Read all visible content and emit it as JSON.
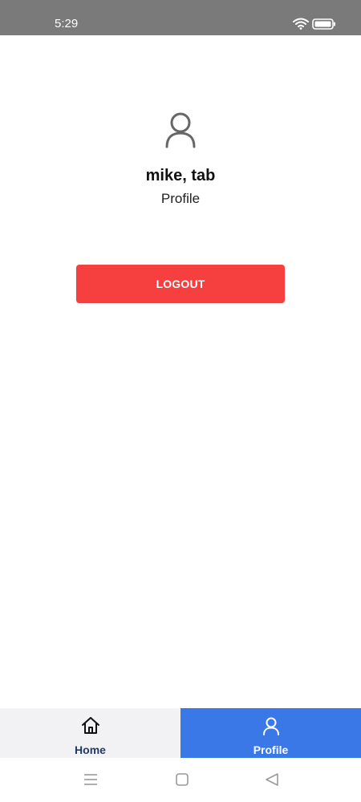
{
  "status_bar": {
    "time": "5:29",
    "wifi_icon": "wifi-icon",
    "battery_icon": "battery-icon"
  },
  "profile": {
    "avatar_icon": "user-outline-icon",
    "name": "mike, tab",
    "subtitle": "Profile"
  },
  "actions": {
    "logout_label": "LOGOUT",
    "logout_color": "#f64040"
  },
  "tab_bar": {
    "tabs": [
      {
        "label": "Home",
        "icon": "home-icon",
        "active": false
      },
      {
        "label": "Profile",
        "icon": "user-outline-icon",
        "active": true
      }
    ],
    "active_color": "#3b78e7"
  },
  "nav_bar": {
    "buttons": [
      "menu-icon",
      "square-home-icon",
      "back-triangle-icon"
    ]
  }
}
